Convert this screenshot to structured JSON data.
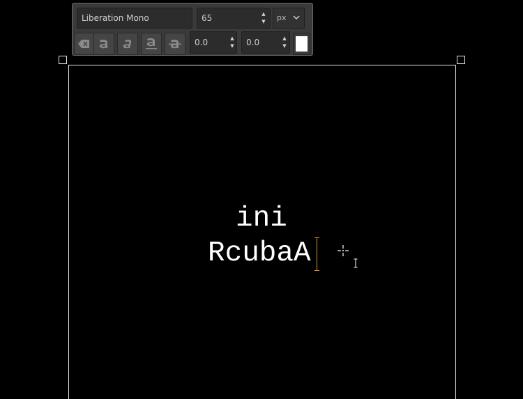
{
  "toolbar": {
    "font_name": "Liberation Mono",
    "font_size": "65",
    "unit": "px",
    "letter_spacing": "0.0",
    "line_spacing": "0.0",
    "text_color": "#ffffff",
    "style_icons": [
      "clear-style-icon",
      "bold-icon",
      "italic-icon",
      "underline-icon",
      "strikethrough-icon"
    ]
  },
  "canvas": {
    "lines": [
      "ini",
      "RcubaA"
    ]
  }
}
